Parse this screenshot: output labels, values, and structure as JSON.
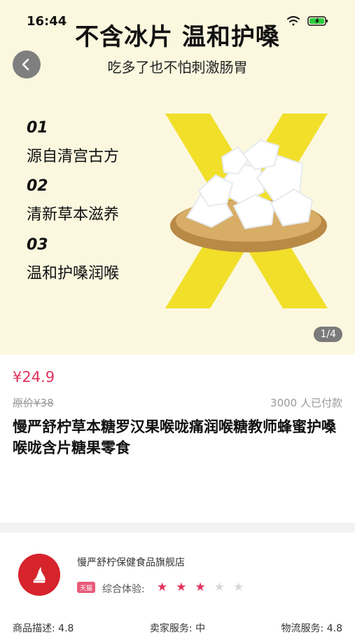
{
  "status": {
    "time": "16:44"
  },
  "hero": {
    "title": "不含冰片 温和护嗓",
    "subtitle": "吃多了也不怕刺激肠胃",
    "features": [
      {
        "num": "01",
        "text": "源自清宫古方"
      },
      {
        "num": "02",
        "text": "清新草本滋养"
      },
      {
        "num": "03",
        "text": "温和护嗓润喉"
      }
    ],
    "pager": "1/4"
  },
  "product": {
    "price": "¥24.9",
    "original_price": "原价¥38",
    "sold": "3000 人已付款",
    "title": "慢严舒柠草本糖罗汉果喉咙痛润喉糖教师蜂蜜护嗓喉咙含片糖果零食"
  },
  "shop": {
    "name": "慢严舒柠保健食品旗舰店",
    "badge": "天猫",
    "experience_label": "综合体验:",
    "stars_filled": 3,
    "stars_total": 5,
    "ratings": {
      "desc": "商品描述: 4.8",
      "seller": "卖家服务: 中",
      "logistics": "物流服务: 4.8"
    }
  },
  "colors": {
    "accent": "#e0335c",
    "heroBg": "#fbf8df",
    "logoRed": "#d6232c",
    "x": "#f1df2a"
  }
}
